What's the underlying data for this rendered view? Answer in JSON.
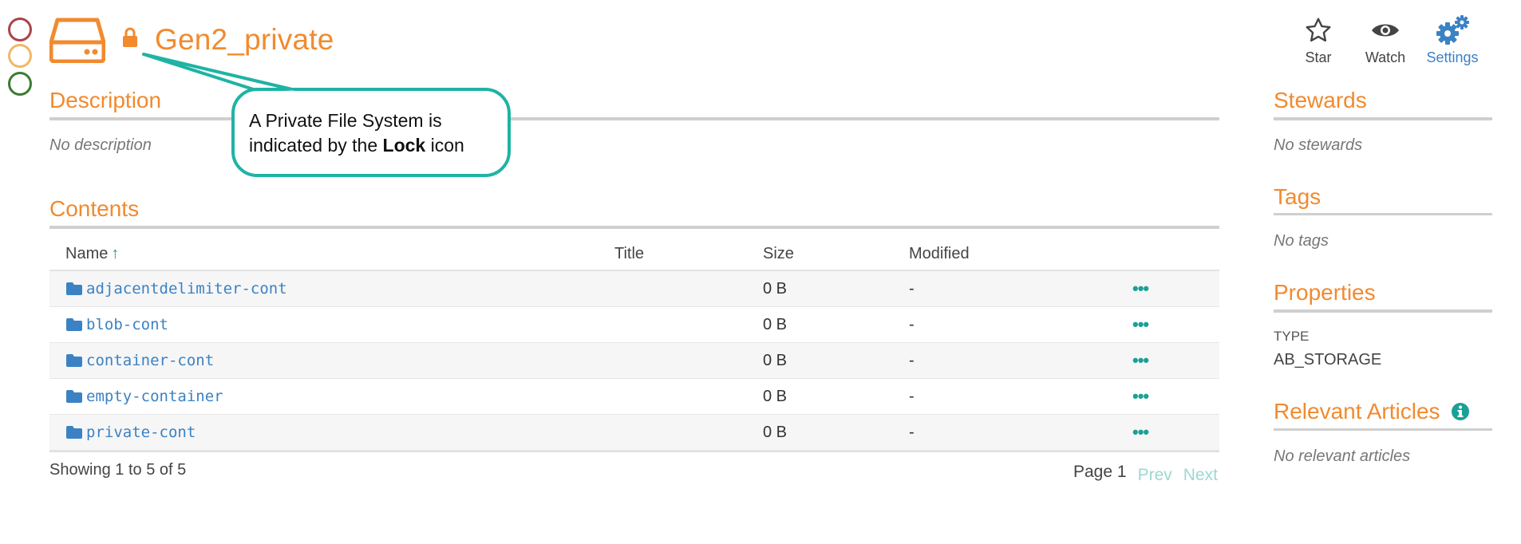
{
  "header": {
    "title": "Gen2_private"
  },
  "actions": {
    "star": "Star",
    "watch": "Watch",
    "settings": "Settings"
  },
  "description": {
    "title": "Description",
    "text": "No description"
  },
  "contents": {
    "title": "Contents",
    "columns": {
      "name": "Name",
      "title": "Title",
      "size": "Size",
      "modified": "Modified"
    },
    "sort_indicator": "↑",
    "rows": [
      {
        "name": "adjacentdelimiter-cont",
        "title": "",
        "size": "0 B",
        "modified": "-",
        "more": "•••"
      },
      {
        "name": "blob-cont",
        "title": "",
        "size": "0 B",
        "modified": "-",
        "more": "•••"
      },
      {
        "name": "container-cont",
        "title": "",
        "size": "0 B",
        "modified": "-",
        "more": "•••"
      },
      {
        "name": "empty-container",
        "title": "",
        "size": "0 B",
        "modified": "-",
        "more": "•••"
      },
      {
        "name": "private-cont",
        "title": "",
        "size": "0 B",
        "modified": "-",
        "more": "•••"
      }
    ],
    "showing": "Showing 1 to 5 of 5",
    "pager": {
      "page": "Page 1",
      "prev": "Prev",
      "next": "Next"
    }
  },
  "sidebar": {
    "stewards": {
      "title": "Stewards",
      "text": "No stewards"
    },
    "tags": {
      "title": "Tags",
      "text": "No tags"
    },
    "properties": {
      "title": "Properties",
      "key": "TYPE",
      "value": "AB_STORAGE"
    },
    "articles": {
      "title": "Relevant Articles",
      "text": "No relevant articles"
    }
  },
  "callout": {
    "line1": "A Private File System is",
    "line2_pre": "indicated by the ",
    "line2_bold": "Lock",
    "line2_post": " icon"
  },
  "colors": {
    "accent": "#f28a2e",
    "link": "#3b82c4",
    "teal": "#1aa195",
    "callout_border": "#1fb3a4"
  },
  "icons": {
    "header": "drive-icon",
    "private": "lock-icon",
    "row": "folder-icon",
    "articles": "info-icon"
  }
}
